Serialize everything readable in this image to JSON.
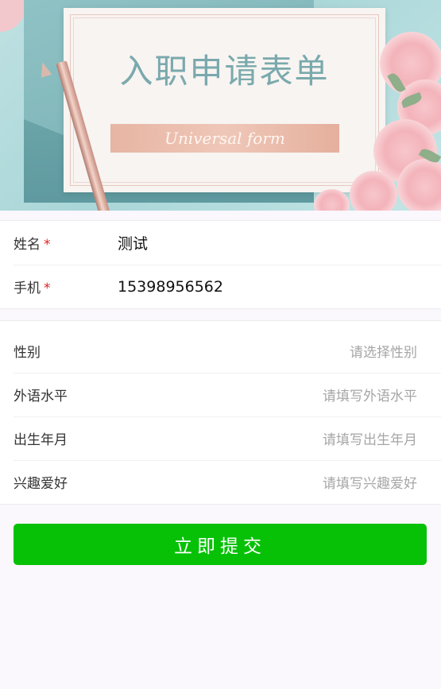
{
  "banner": {
    "title": "入职申请表单",
    "subtitle": "Universal form"
  },
  "form": {
    "required_fields": [
      {
        "label": "姓名",
        "required_mark": "*",
        "value": "测试"
      },
      {
        "label": "手机",
        "required_mark": "*",
        "value": "15398956562"
      }
    ],
    "optional_fields": [
      {
        "label": "性别",
        "placeholder": "请选择性别"
      },
      {
        "label": "外语水平",
        "placeholder": "请填写外语水平"
      },
      {
        "label": "出生年月",
        "placeholder": "请填写出生年月"
      },
      {
        "label": "兴趣爱好",
        "placeholder": "请填写兴趣爱好"
      }
    ],
    "submit_label": "立即提交"
  },
  "colors": {
    "submit_green": "#07c107",
    "required_red": "#e02020",
    "page_bg": "#faf7fd"
  }
}
